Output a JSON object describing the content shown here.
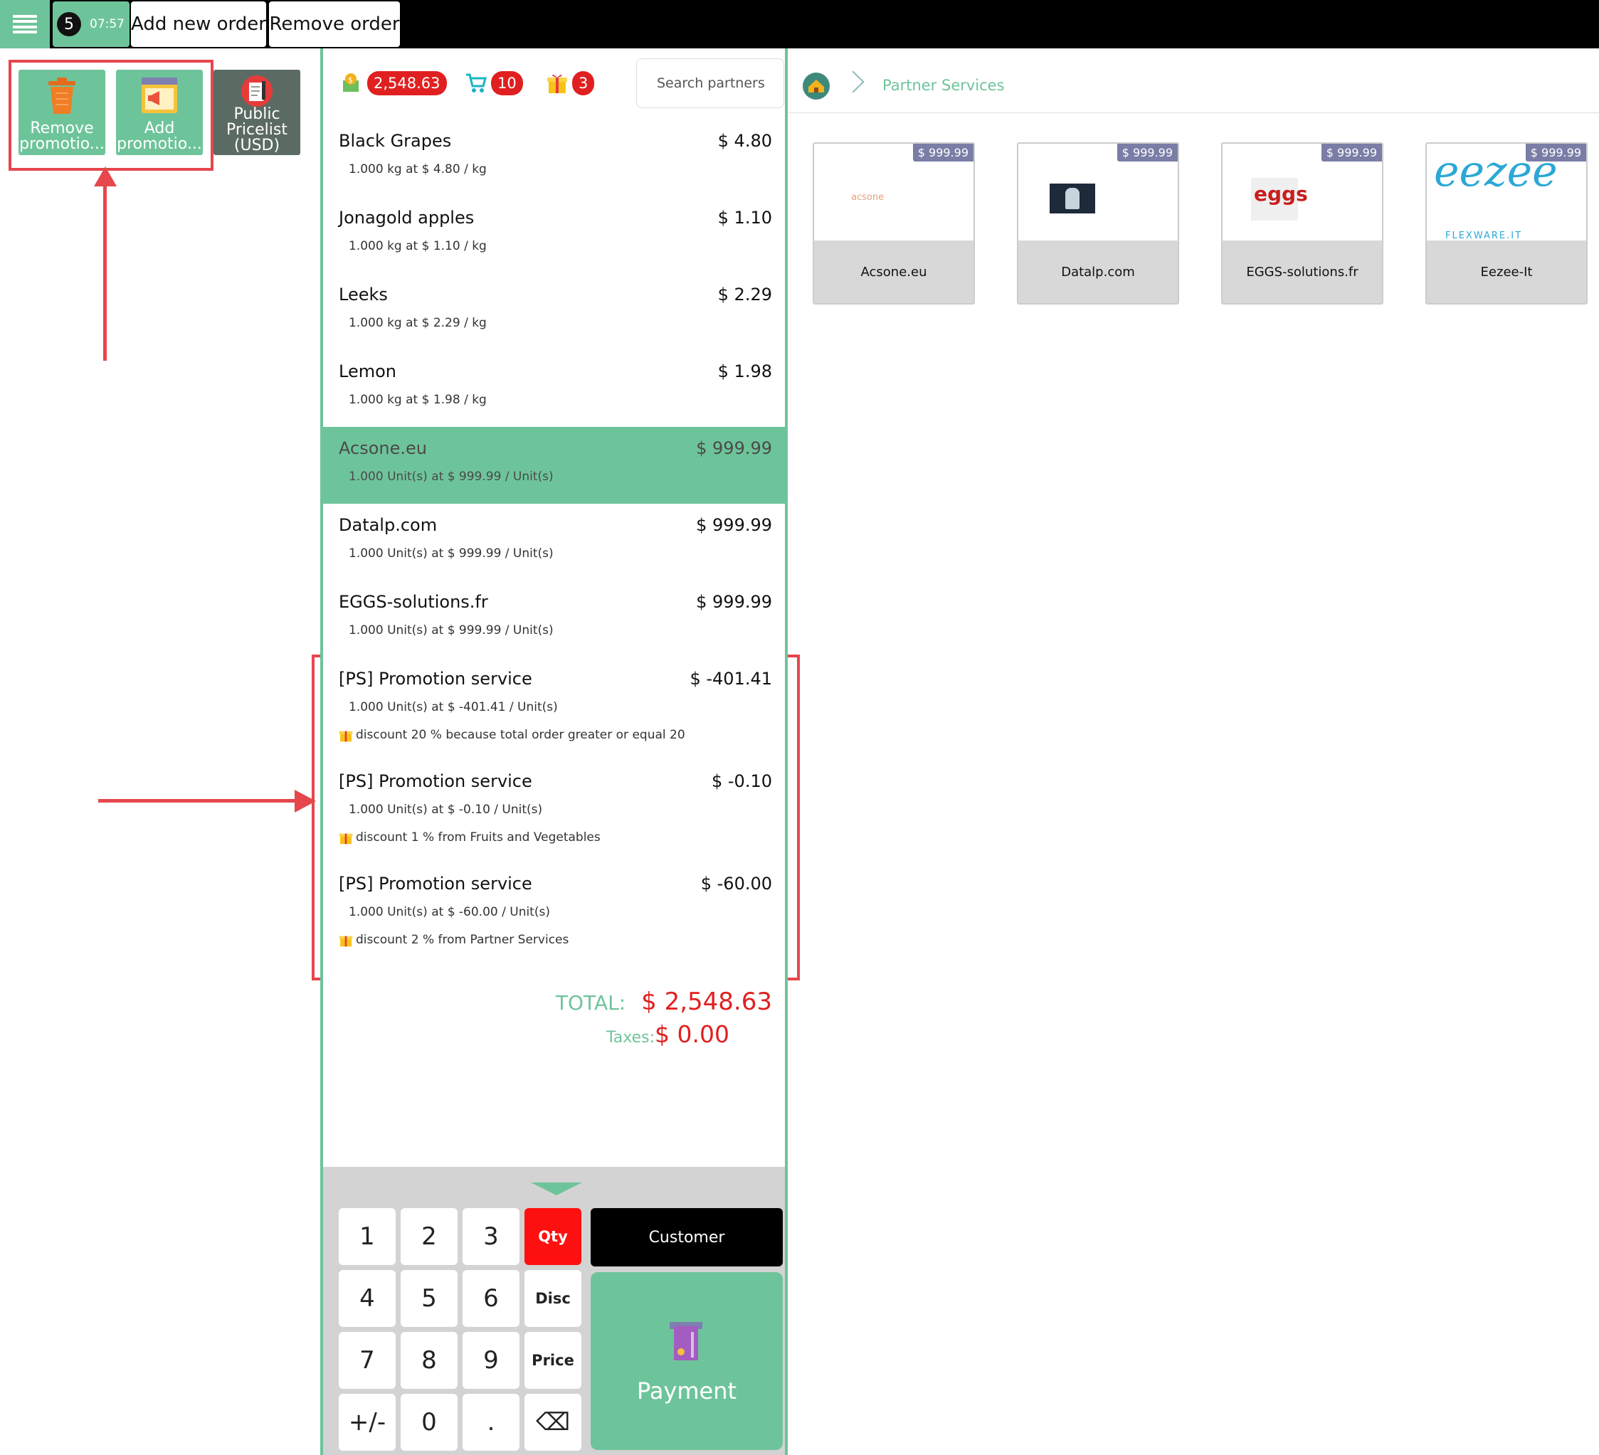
{
  "topbar": {
    "order_number": "5",
    "order_time": "07:57",
    "add_order_label": "Add new order",
    "remove_order_label": "Remove order"
  },
  "controls": [
    {
      "label_line1": "Remove",
      "label_line2": "promotio..."
    },
    {
      "label_line1": "Add",
      "label_line2": "promotio..."
    },
    {
      "label_line1": "Public",
      "label_line2": "Pricelist",
      "label_line3": "(USD)"
    }
  ],
  "stats": {
    "amount": "2,548.63",
    "cart_count": "10",
    "gift_count": "3"
  },
  "search": {
    "placeholder": "Search partners"
  },
  "order_lines": [
    {
      "name": "Black Grapes",
      "price": "$ 4.80",
      "detail": "1.000 kg at $ 4.80 / kg"
    },
    {
      "name": "Jonagold apples",
      "price": "$ 1.10",
      "detail": "1.000 kg at $ 1.10 / kg"
    },
    {
      "name": "Leeks",
      "price": "$ 2.29",
      "detail": "1.000 kg at $ 2.29 / kg"
    },
    {
      "name": "Lemon",
      "price": "$ 1.98",
      "detail": "1.000 kg at $ 1.98 / kg"
    },
    {
      "name": "Acsone.eu",
      "price": "$ 999.99",
      "detail": "1.000 Unit(s) at $ 999.99 / Unit(s)"
    },
    {
      "name": "Datalp.com",
      "price": "$ 999.99",
      "detail": "1.000 Unit(s) at $ 999.99 / Unit(s)"
    },
    {
      "name": "EGGS-solutions.fr",
      "price": "$ 999.99",
      "detail": "1.000 Unit(s) at $ 999.99 / Unit(s)"
    },
    {
      "name": "[PS] Promotion service",
      "price": "$ -401.41",
      "detail": "1.000 Unit(s) at $ -401.41 / Unit(s)",
      "note": "discount 20 % because total order greater or equal 20"
    },
    {
      "name": "[PS] Promotion service",
      "price": "$ -0.10",
      "detail": "1.000 Unit(s) at $ -0.10 / Unit(s)",
      "note": "discount 1 % from Fruits and Vegetables"
    },
    {
      "name": "[PS] Promotion service",
      "price": "$ -60.00",
      "detail": "1.000 Unit(s) at $ -60.00 / Unit(s)",
      "note": "discount 2 % from Partner Services"
    }
  ],
  "totals": {
    "total_label": "TOTAL:",
    "total_value": "$ 2,548.63",
    "taxes_label": "Taxes:",
    "taxes_value": "$ 0.00"
  },
  "keypad": {
    "keys": [
      "1",
      "2",
      "3",
      "Qty",
      "4",
      "5",
      "6",
      "Disc",
      "7",
      "8",
      "9",
      "Price",
      "+/-",
      "0",
      ".",
      "⌫"
    ],
    "customer_label": "Customer",
    "payment_label": "Payment"
  },
  "breadcrumb": {
    "category": "Partner Services"
  },
  "products": [
    {
      "name": "Acsone.eu",
      "price": "$ 999.99",
      "logo_text": "acsone"
    },
    {
      "name": "Datalp.com",
      "price": "$ 999.99",
      "logo_text": ""
    },
    {
      "name": "EGGS-solutions.fr",
      "price": "$ 999.99",
      "logo_text": "eggs"
    },
    {
      "name": "Eezee-It",
      "price": "$ 999.99",
      "logo_text": "eezee",
      "logo_sub": "FLEXWARE.IT"
    }
  ],
  "colors": {
    "accent": "#6ec49a",
    "alert": "#e02020",
    "annotation": "#e5474d"
  }
}
